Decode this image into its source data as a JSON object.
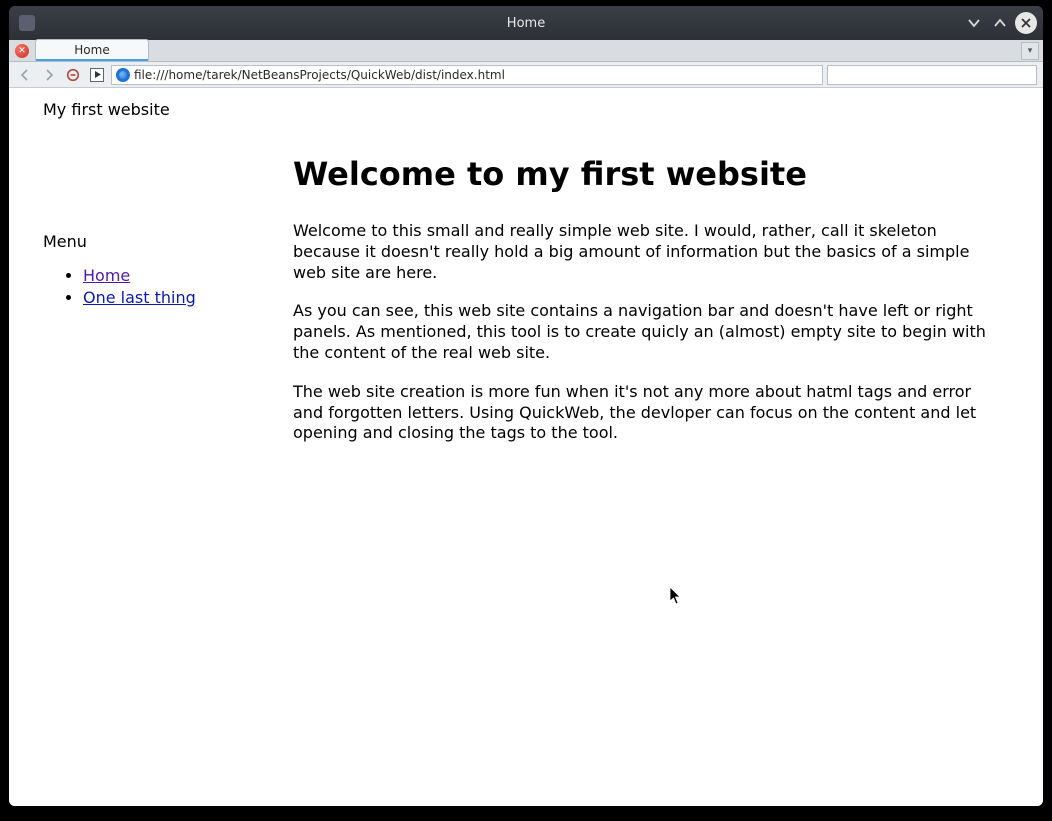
{
  "window": {
    "title": "Home"
  },
  "browser": {
    "tab_label": "Home",
    "url": "file:///home/tarek/NetBeansProjects/QuickWeb/dist/index.html"
  },
  "page": {
    "site_title": "My first website",
    "menu_heading": "Menu",
    "nav": [
      {
        "label": "Home"
      },
      {
        "label": "One last thing"
      }
    ],
    "heading": "Welcome to my first website",
    "paragraphs": [
      "Welcome to this small and really simple web site. I would, rather, call it skeleton because it doesn't really hold a big amount of information but the basics of a simple web site are here.",
      "As you can see, this web site contains a navigation bar and doesn't have left or right panels. As mentioned, this tool is to create quicly an (almost) empty site to begin with the content of the real web site.",
      "The web site creation is more fun when it's not any more about hatml tags and error and forgotten letters. Using QuickWeb, the devloper can focus on the content and let opening and closing the tags to the tool."
    ]
  }
}
